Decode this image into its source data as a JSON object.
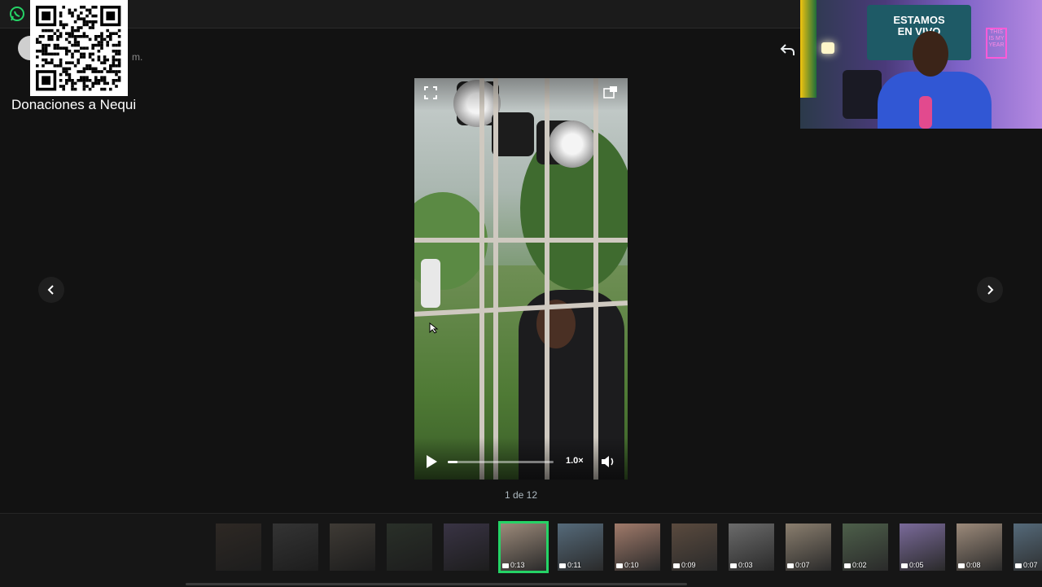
{
  "overlay": {
    "donation_label": "Donaciones a Nequi",
    "meta_suffix": "m."
  },
  "webcam": {
    "banner_line1": "ESTAMOS",
    "banner_line2": "EN VIVO",
    "sign_text": "THIS IS MY YEAR"
  },
  "viewer": {
    "counter": "1 de 12",
    "speed": "1.0×",
    "progress_fraction": 0.09,
    "accent_color": "#25d366"
  },
  "icons": {
    "whatsapp": "whatsapp-icon",
    "reply": "reply-icon",
    "prev": "chevron-left-icon",
    "next": "chevron-right-icon",
    "expand": "fullscreen-icon",
    "popout": "popout-icon",
    "play": "play-icon",
    "volume": "volume-icon"
  },
  "thumbnails": [
    {
      "kind": "image",
      "duration": "",
      "state": "dim"
    },
    {
      "kind": "image",
      "duration": "",
      "state": "dim"
    },
    {
      "kind": "image",
      "duration": "",
      "state": "dim"
    },
    {
      "kind": "image",
      "duration": "",
      "state": "dim"
    },
    {
      "kind": "image",
      "duration": "",
      "state": "dim"
    },
    {
      "kind": "video",
      "duration": "0:13",
      "state": "active"
    },
    {
      "kind": "video",
      "duration": "0:11",
      "state": "normal"
    },
    {
      "kind": "video",
      "duration": "0:10",
      "state": "normal"
    },
    {
      "kind": "video",
      "duration": "0:09",
      "state": "normal"
    },
    {
      "kind": "video",
      "duration": "0:03",
      "state": "normal"
    },
    {
      "kind": "video",
      "duration": "0:07",
      "state": "normal"
    },
    {
      "kind": "video",
      "duration": "0:02",
      "state": "normal"
    },
    {
      "kind": "video",
      "duration": "0:05",
      "state": "normal"
    },
    {
      "kind": "video",
      "duration": "0:08",
      "state": "normal"
    },
    {
      "kind": "video",
      "duration": "0:07",
      "state": "normal"
    }
  ]
}
